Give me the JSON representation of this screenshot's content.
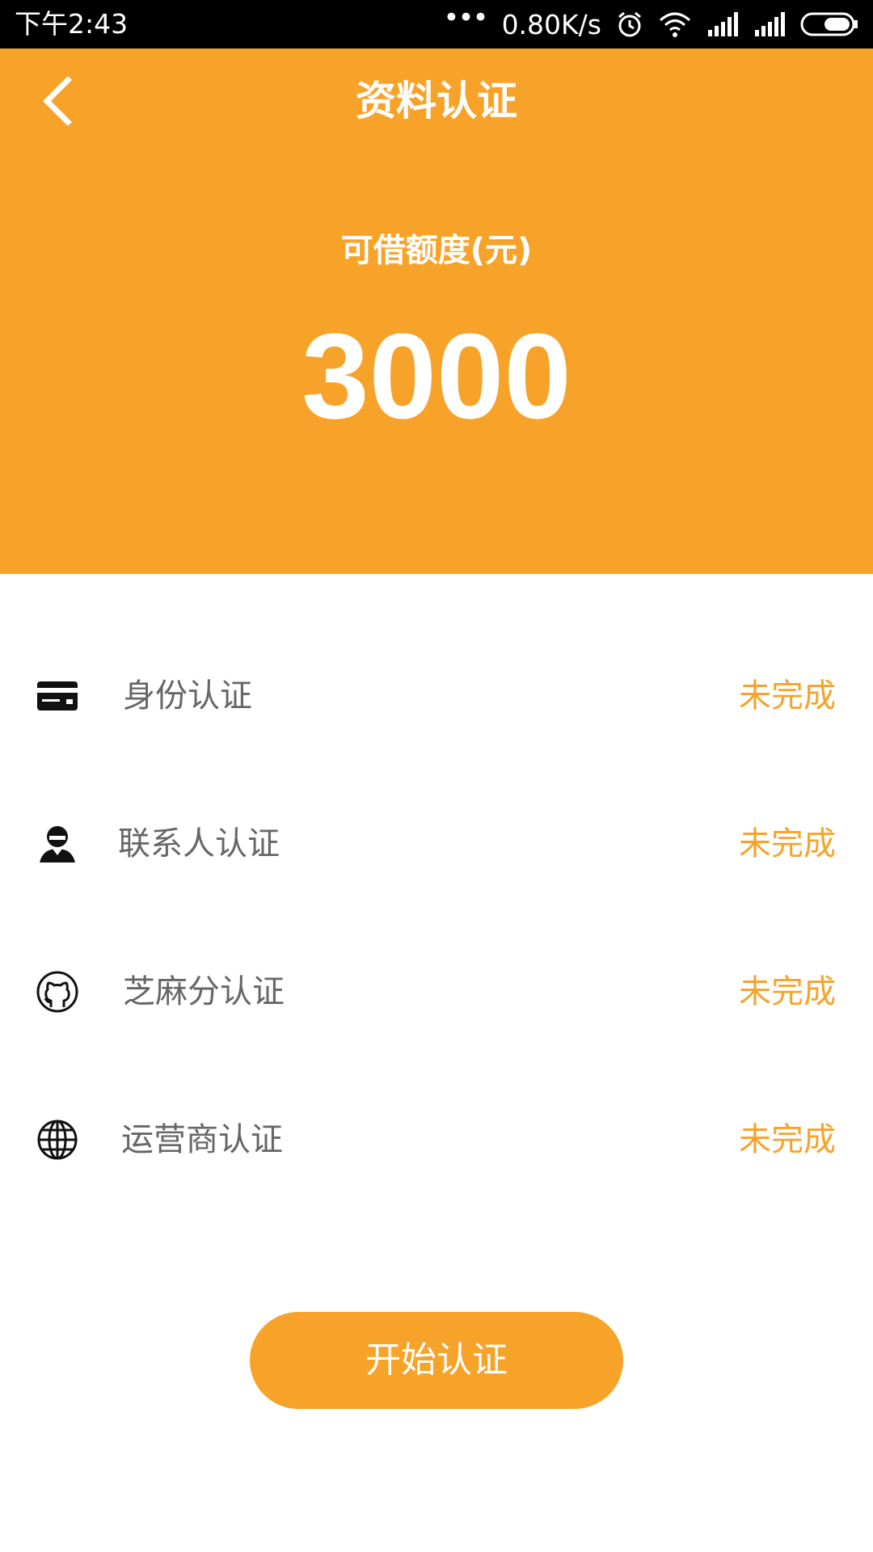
{
  "status_bar": {
    "time": "下午2:43",
    "dots": "•••",
    "net_speed": "0.80K/s",
    "icons": [
      "alarm-icon",
      "wifi-icon",
      "signal-icon",
      "signal-icon",
      "battery-icon"
    ]
  },
  "header": {
    "title": "资料认证",
    "credit_label": "可借额度(元)",
    "credit_amount": "3000",
    "background_color": "#f7a32a"
  },
  "verify_items": [
    {
      "icon": "id-card-icon",
      "label": "身份认证",
      "status": "未完成"
    },
    {
      "icon": "contact-person-icon",
      "label": "联系人认证",
      "status": "未完成"
    },
    {
      "icon": "sesame-github-icon",
      "label": "芝麻分认证",
      "status": "未完成"
    },
    {
      "icon": "globe-icon",
      "label": "运营商认证",
      "status": "未完成"
    }
  ],
  "actions": {
    "start_label": "开始认证"
  },
  "colors": {
    "accent": "#f7a32a",
    "label_text": "#666666",
    "status_text": "#f7a32a"
  }
}
